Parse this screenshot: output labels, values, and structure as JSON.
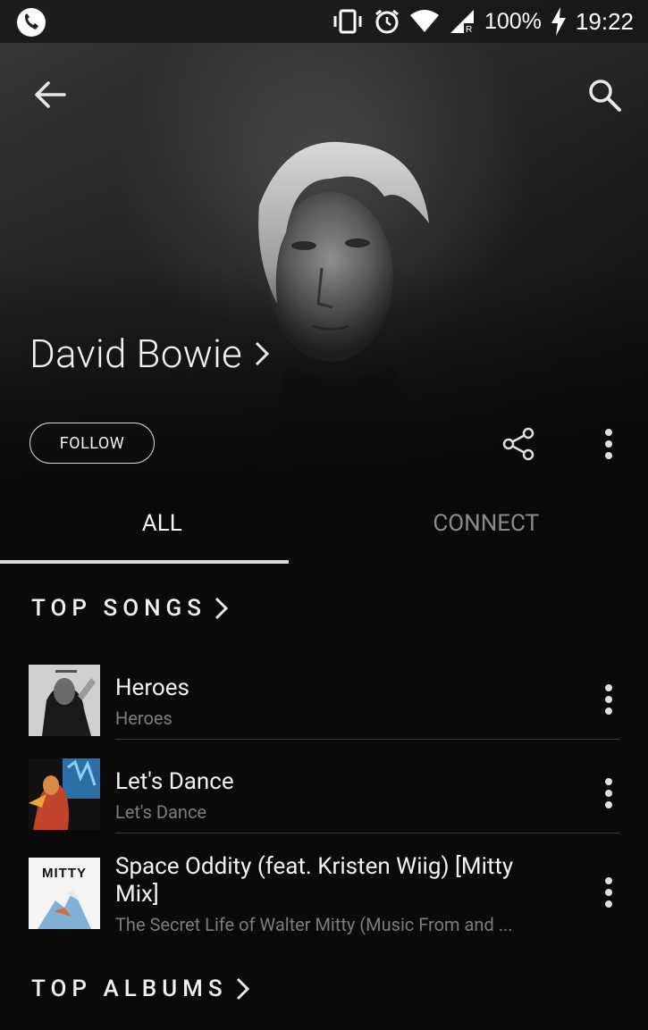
{
  "status_bar": {
    "battery": "100%",
    "time": "19:22",
    "icons": [
      "phone-call-icon",
      "vibrate-icon",
      "alarm-icon",
      "wifi-icon",
      "cell-signal-icon",
      "charging-icon"
    ]
  },
  "header": {
    "artist_name": "David Bowie",
    "follow_label": "FOLLOW"
  },
  "tabs": [
    {
      "label": "ALL",
      "active": true
    },
    {
      "label": "CONNECT",
      "active": false
    }
  ],
  "top_songs": {
    "title": "TOP SONGS",
    "items": [
      {
        "title": "Heroes",
        "subtitle": "Heroes"
      },
      {
        "title": "Let's Dance",
        "subtitle": "Let's Dance"
      },
      {
        "title": "Space Oddity (feat. Kristen Wiig) [Mitty Mix]",
        "subtitle": "The Secret Life of Walter Mitty (Music From and ...",
        "cover_text": "MITTY"
      }
    ]
  },
  "top_albums": {
    "title": "TOP ALBUMS"
  },
  "colors": {
    "background": "#0a0a0a",
    "text_primary": "#f2f2f2",
    "text_secondary": "#7c7c7c",
    "tab_indicator": "#d9d9d9"
  }
}
